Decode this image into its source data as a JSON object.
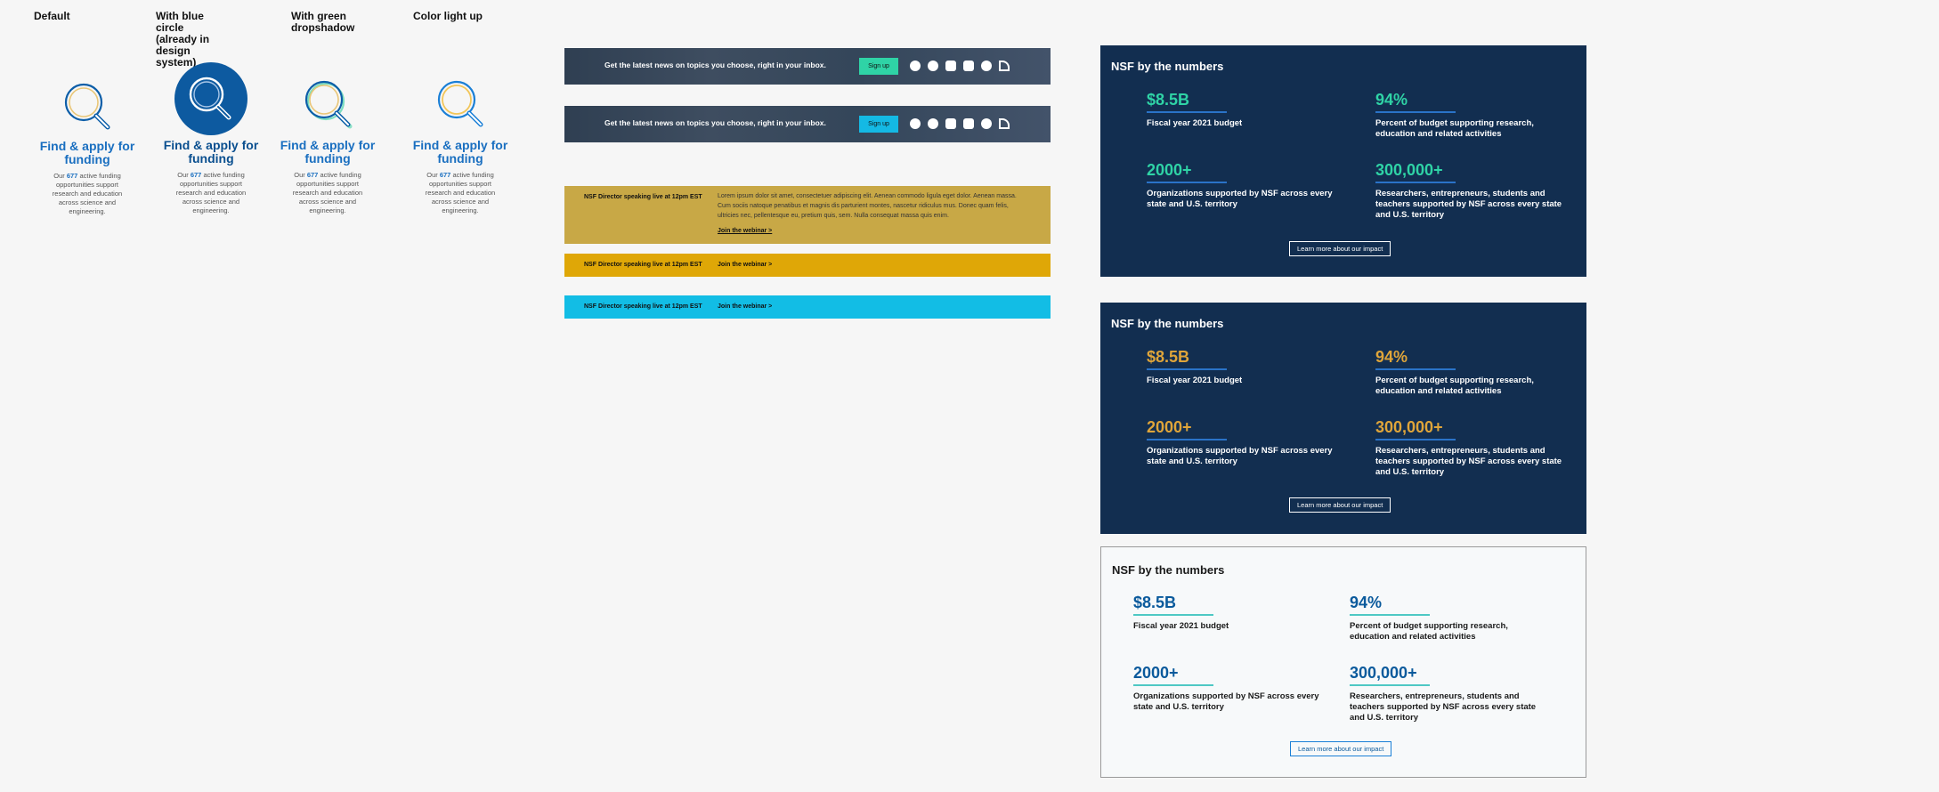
{
  "variants": [
    {
      "heading": "Default"
    },
    {
      "heading": "With blue circle (already in design system)"
    },
    {
      "heading": "With green dropshadow"
    },
    {
      "heading": "Color light up"
    }
  ],
  "funding_card": {
    "title": "Find & apply for funding",
    "desc_prefix": "Our",
    "count": "677",
    "desc_suffix": "active funding opportunities support research and education across science and engineering."
  },
  "newsletter": {
    "text": "Get the latest news on topics you choose, right in your inbox.",
    "signup_label": "Sign up",
    "social_icons": [
      "facebook-icon",
      "twitter-icon",
      "instagram-icon",
      "youtube-icon",
      "linkedin-icon",
      "rss-icon"
    ],
    "colors": {
      "signup_green": "#2fd3a6",
      "signup_blue": "#14b9e4"
    }
  },
  "banners": {
    "label": "NSF Director speaking live at 12pm EST",
    "body": "Lorem ipsum dolor sit amet, consectetuer adipiscing elit. Aenean commodo ligula eget dolor. Aenean massa. Cum sociis natoque penatibus et magnis dis parturient montes, nascetur ridiculus mus. Donec quam felis, ultricies nec, pellentesque eu, pretium quis, sem. Nulla consequat massa quis enim.",
    "join_label": "Join the webinar >",
    "colors": {
      "muted_gold": "#c8a846",
      "gold": "#dfa707",
      "cyan": "#12bde5"
    }
  },
  "stats": {
    "title": "NSF by the numbers",
    "items": [
      {
        "value": "$8.5B",
        "desc": "Fiscal year 2021 budget"
      },
      {
        "value": "94%",
        "desc": "Percent of budget supporting research, education and related activities"
      },
      {
        "value": "2000+",
        "desc": "Organizations supported by NSF across every state and U.S. territory"
      },
      {
        "value": "300,000+",
        "desc": "Researchers, entrepreneurs, students and teachers supported by NSF across every state and U.S. territory"
      }
    ],
    "learn_label": "Learn more about our impact",
    "colors": {
      "navy": "#122e50",
      "green": "#2fd3a6",
      "gold": "#dfa53a",
      "blue_value": "#0a5a9c",
      "rule_blue": "#2a73c8",
      "rule_teal": "#4ec8c4"
    }
  }
}
